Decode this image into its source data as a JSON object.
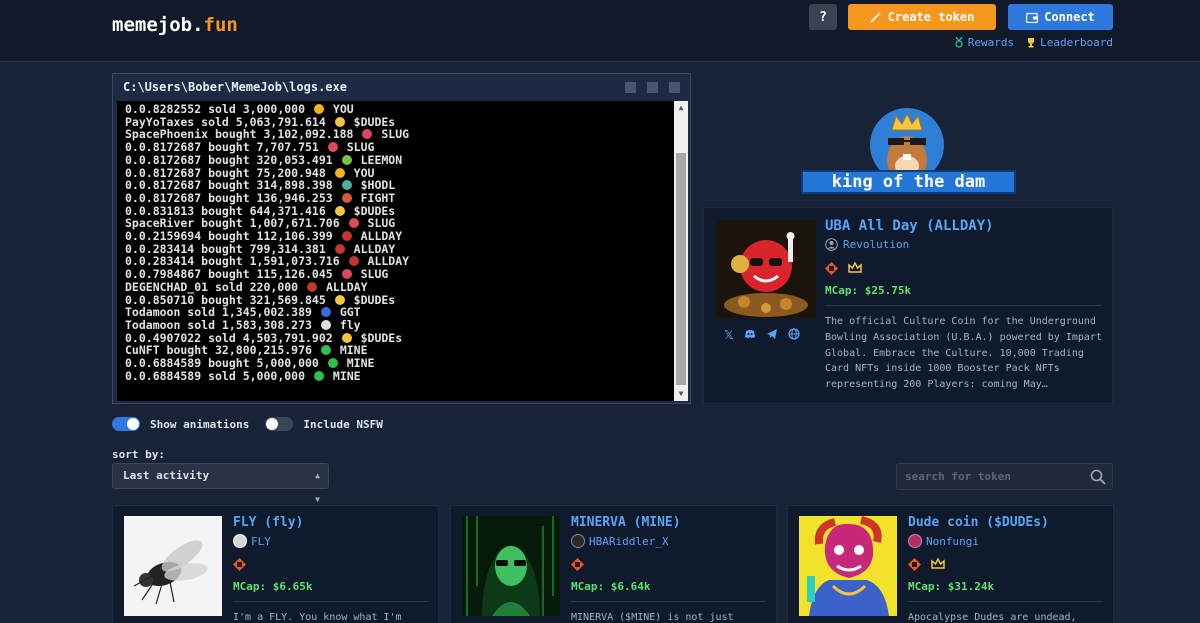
{
  "header": {
    "logo_main": "memejob.",
    "logo_accent": "fun",
    "help_label": "?",
    "create_label": "Create token",
    "connect_label": "Connect",
    "rewards_label": "Rewards",
    "leaderboard_label": "Leaderboard"
  },
  "terminal": {
    "title": "C:\\Users\\Bober\\MemeJob\\logs.exe",
    "lines": [
      {
        "text": "0.0.8282552 sold 3,000,000",
        "icon_color": "#f5b21d",
        "token": "YOU"
      },
      {
        "text": "PayYoTaxes sold 5,063,791.614",
        "icon_color": "#f5c542",
        "token": "$DUDEs"
      },
      {
        "text": "SpacePhoenix bought 3,102,092.188",
        "icon_color": "#d94a5a",
        "token": "SLUG"
      },
      {
        "text": "0.0.8172687 bought 7,707.751",
        "icon_color": "#d94a5a",
        "token": "SLUG"
      },
      {
        "text": "0.0.8172687 bought 320,053.491",
        "icon_color": "#7fbf3f",
        "token": "LEEMON"
      },
      {
        "text": "0.0.8172687 bought 75,200.948",
        "icon_color": "#f5b21d",
        "token": "YOU"
      },
      {
        "text": "0.0.8172687 bought 314,898.398",
        "icon_color": "#4ab0a0",
        "token": "$HODL"
      },
      {
        "text": "0.0.8172687 bought 136,946.253",
        "icon_color": "#d95a3a",
        "token": "FIGHT"
      },
      {
        "text": "0.0.831813 bought 644,371.416",
        "icon_color": "#f5c542",
        "token": "$DUDEs"
      },
      {
        "text": "SpaceRiver bought 1,007,671.706",
        "icon_color": "#d94a5a",
        "token": "SLUG"
      },
      {
        "text": "0.0.2159694 bought 112,106.399",
        "icon_color": "#c0392b",
        "token": "ALLDAY"
      },
      {
        "text": "0.0.283414 bought 799,314.381",
        "icon_color": "#c0392b",
        "token": "ALLDAY"
      },
      {
        "text": "0.0.283414 bought 1,591,073.716",
        "icon_color": "#c0392b",
        "token": "ALLDAY"
      },
      {
        "text": "0.0.7984867 bought 115,126.045",
        "icon_color": "#d94a5a",
        "token": "SLUG"
      },
      {
        "text": "DEGENCHAD_01 sold 220,000",
        "icon_color": "#c0392b",
        "token": "ALLDAY"
      },
      {
        "text": "0.0.850710 bought 321,569.845",
        "icon_color": "#f5c542",
        "token": "$DUDEs"
      },
      {
        "text": "Todamoon sold 1,345,002.389",
        "icon_color": "#3a6ad9",
        "token": "GGT"
      },
      {
        "text": "Todamoon sold 1,583,308.273",
        "icon_color": "#e0e0e0",
        "token": "fly"
      },
      {
        "text": "0.0.4907022 sold 4,503,791.902",
        "icon_color": "#f5c542",
        "token": "$DUDEs"
      },
      {
        "text": "CuNFT bought 32,800,215.976",
        "icon_color": "#2fbf4f",
        "token": "MINE"
      },
      {
        "text": "0.0.6884589 bought 5,000,000",
        "icon_color": "#2fbf4f",
        "token": "MINE"
      },
      {
        "text": "0.0.6884589 sold 5,000,000",
        "icon_color": "#2fbf4f",
        "token": "MINE"
      }
    ]
  },
  "king": {
    "banner": "king of the dam",
    "title": "UBA All Day (ALLDAY)",
    "creator": "Revolution",
    "mcap": "MCap: $25.75k",
    "description": "The official Culture Coin for the Underground Bowling Association (U.B.A.) powered by Impart Global. Embrace the Culture. 10,000 Trading Card NFTs inside 1000 Booster Pack NFTs representing 200 Players: coming May…"
  },
  "controls": {
    "show_animations": "Show animations",
    "include_nsfw": "Include NSFW",
    "sort_label": "sort by:",
    "sort_value": "Last activity",
    "search_placeholder": "search for token"
  },
  "cards": [
    {
      "title": "FLY (fly)",
      "creator": "FLY",
      "mcap": "MCap: $6.65k",
      "desc": "I'm a FLY. You know what I'm",
      "creator_color": "#d8d8d8"
    },
    {
      "title": "MINERVA (MINE)",
      "creator": "HBARiddler_X",
      "mcap": "MCap: $6.64k",
      "desc": "MINERVA ($MINE) is not just",
      "creator_color": "#2a2a2a"
    },
    {
      "title": "Dude coin ($DUDEs)",
      "creator": "Nonfungi",
      "mcap": "MCap: $31.24k",
      "desc": "Apocalypse Dudes are undead,",
      "creator_color": "#b0306a"
    }
  ],
  "colors": {
    "accent_orange": "#f5961d",
    "accent_blue": "#2f78dc",
    "link_blue": "#5ba4f5",
    "mcap_green": "#5fe06f"
  }
}
